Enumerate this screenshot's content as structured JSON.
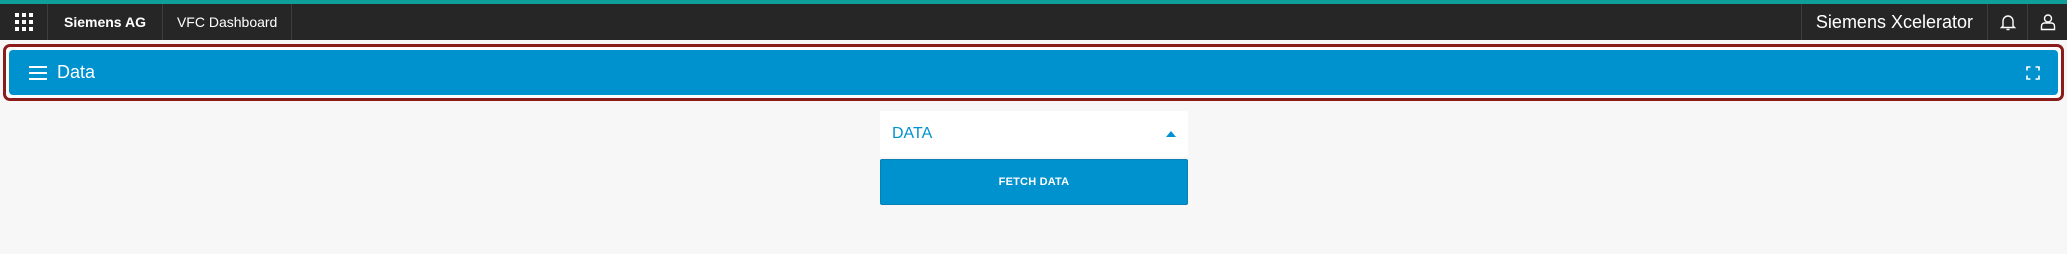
{
  "topbar": {
    "apps_icon": "app-grid-icon",
    "breadcrumbs": [
      "Siemens AG",
      "VFC Dashboard"
    ],
    "brand": "Siemens Xcelerator",
    "icons": [
      "bell-icon",
      "user-icon"
    ]
  },
  "header": {
    "title": "Data",
    "menu_icon": "hamburger-icon",
    "expand_icon": "fullscreen-icon"
  },
  "panel": {
    "title": "DATA",
    "caret_icon": "caret-up-icon",
    "button_label": "FETCH DATA"
  },
  "colors": {
    "accent_strip": "#0e9f9a",
    "topbar": "#262626",
    "primary": "#0091cf",
    "focus_border": "#8a1c1c",
    "background": "#f7f7f7"
  }
}
